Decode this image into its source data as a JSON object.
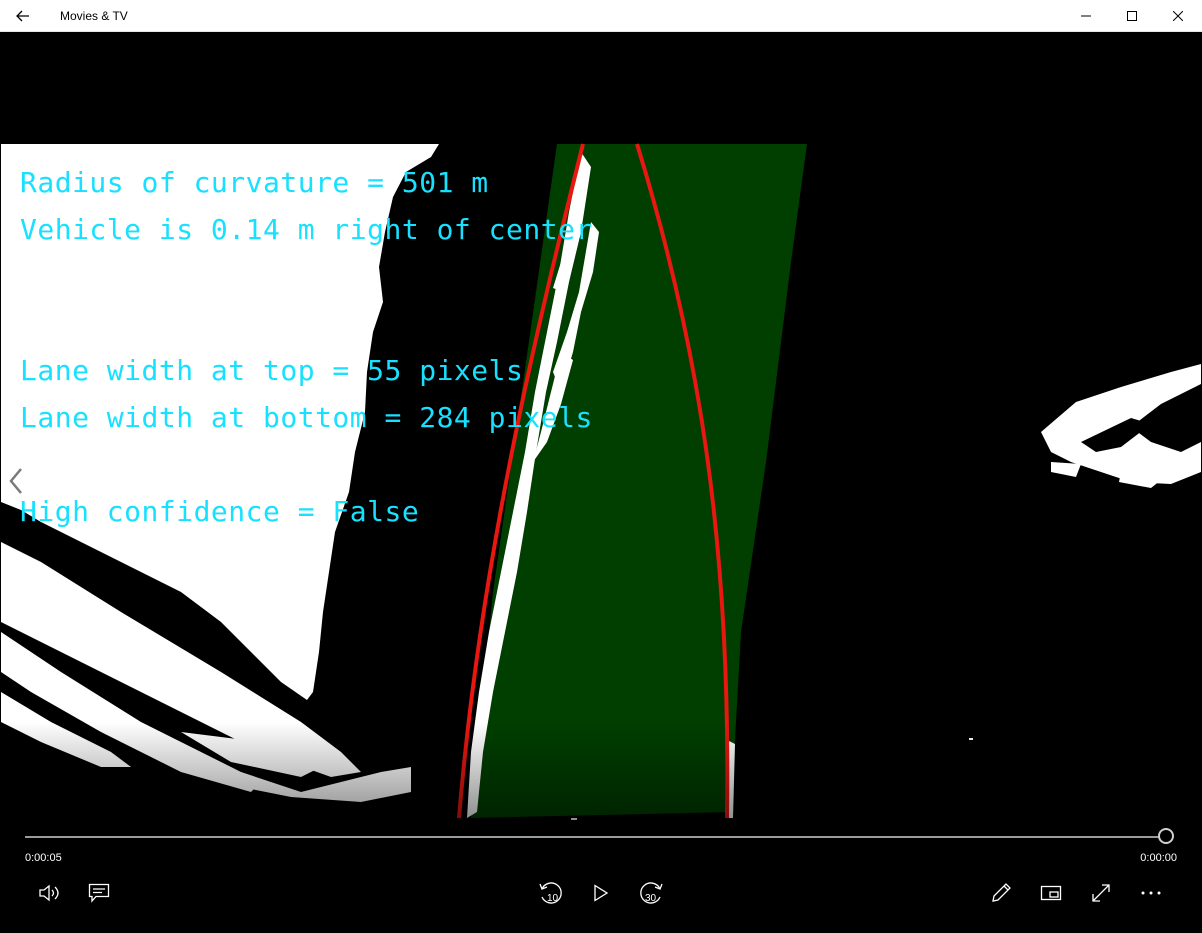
{
  "window": {
    "title": "Movies & TV"
  },
  "overlay": {
    "line1": "Radius of curvature = 501 m",
    "line2": "Vehicle is 0.14 m right of center",
    "line3": "Lane width at top = 55 pixels",
    "line4": "Lane width at bottom = 284 pixels",
    "line5": "High confidence = False",
    "text_color": "#18e0ff"
  },
  "playback": {
    "elapsed": "0:00:05",
    "remaining": "0:00:00",
    "progress": 1.0
  },
  "controls": {
    "rewind_seconds": "10",
    "forward_seconds": "30"
  },
  "colors": {
    "lane_fill": "#003f00",
    "lane_line": "#e8170f",
    "background": "#000000"
  }
}
